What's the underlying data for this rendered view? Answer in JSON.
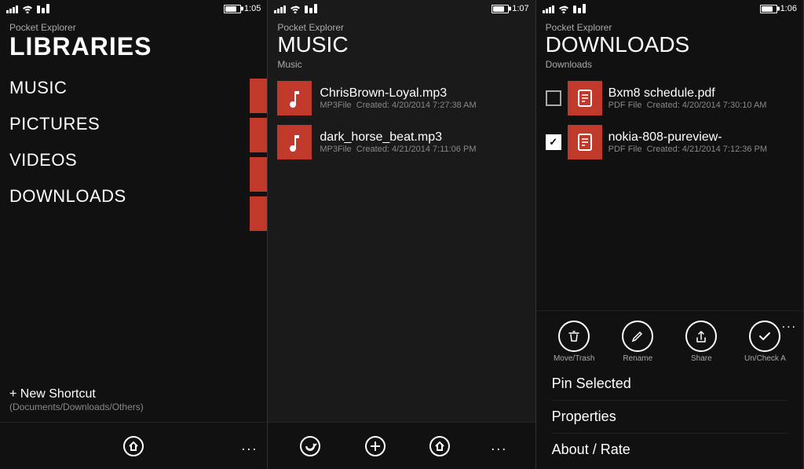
{
  "panels": [
    {
      "id": "libraries",
      "appName": "Pocket Explorer",
      "pageTitle": "LIBRARIES",
      "statusTime": "1:05",
      "items": [
        "MUSIC",
        "PICTURES",
        "VIDEOS",
        "DOWNLOADS"
      ],
      "shortcut": {
        "label": "+ New Shortcut",
        "sublabel": "(Documents/Downloads/Others)"
      },
      "bottomBar": {
        "icons": [
          "home-icon"
        ],
        "more": "..."
      }
    },
    {
      "id": "music",
      "appName": "Pocket Explorer",
      "pageTitle": "MUSIC",
      "breadcrumb": "Music",
      "statusTime": "1:07",
      "files": [
        {
          "name": "ChrisBrown-Loyal.mp3",
          "type": "MP3File",
          "created": "Created: 4/20/2014 7:27:38 AM"
        },
        {
          "name": "dark_horse_beat.mp3",
          "type": "MP3File",
          "created": "Created: 4/21/2014 7:11:06 PM"
        }
      ],
      "bottomBar": {
        "icons": [
          "refresh-icon",
          "add-icon",
          "home-icon"
        ],
        "more": "..."
      }
    },
    {
      "id": "downloads",
      "appName": "Pocket Explorer",
      "pageTitle": "DOWNLOADS",
      "breadcrumb": "Downloads",
      "statusTime": "1:06",
      "files": [
        {
          "name": "Bxm8 schedule.pdf",
          "type": "PDF File",
          "created": "Created: 4/20/2014 7:30:10 AM",
          "checked": false
        },
        {
          "name": "nokia-808-pureview-",
          "type": "PDF File",
          "created": "Created: 4/21/2014 7:12:36 PM",
          "checked": true
        }
      ],
      "toolbar": {
        "buttons": [
          {
            "label": "Move/Trash",
            "icon": "trash-icon"
          },
          {
            "label": "Rename",
            "icon": "rename-icon"
          },
          {
            "label": "Share",
            "icon": "share-icon"
          },
          {
            "label": "Un/Check A",
            "icon": "check-icon"
          }
        ],
        "more": "..."
      },
      "contextMenu": [
        "Pin Selected",
        "Properties",
        "About / Rate"
      ]
    }
  ]
}
